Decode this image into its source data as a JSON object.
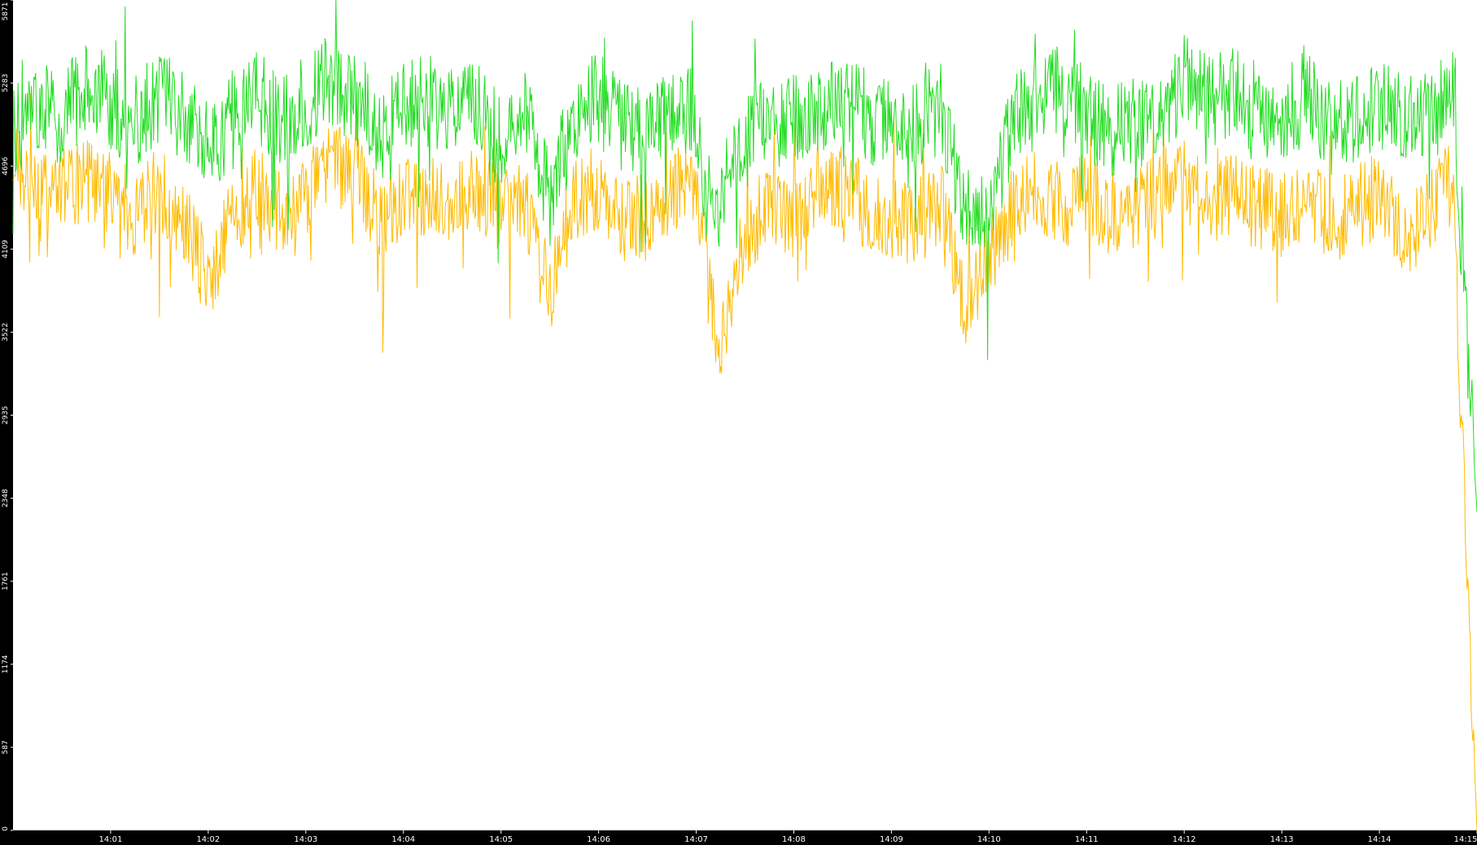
{
  "chart_data": {
    "type": "line",
    "title": "",
    "xlabel": "",
    "ylabel": "",
    "ylim": [
      0,
      5871
    ],
    "xlim": [
      "14:00:00",
      "14:15:00"
    ],
    "grid": false,
    "legend": "none",
    "background_color": "#000000",
    "plot_background_color": "#ffffff",
    "y_tick_labels": [
      "0",
      "587",
      "1174",
      "1761",
      "2348",
      "2935",
      "3522",
      "4109",
      "4696",
      "5283",
      "5871"
    ],
    "x_tick_labels": [
      "14:01",
      "14:02",
      "14:03",
      "14:04",
      "14:05",
      "14:06",
      "14:07",
      "14:08",
      "14:09",
      "14:10",
      "14:11",
      "14:12",
      "14:13",
      "14:14",
      "14:15"
    ],
    "x_tick_minutes": [
      1,
      2,
      3,
      4,
      5,
      6,
      7,
      8,
      9,
      10,
      11,
      12,
      13,
      14,
      15
    ],
    "series": [
      {
        "color": "#22dd22",
        "values": [
          [
            0.0,
            4950
          ],
          [
            0.25,
            5100
          ],
          [
            0.5,
            5050
          ],
          [
            0.75,
            5250
          ],
          [
            1.0,
            5150
          ],
          [
            1.25,
            5000
          ],
          [
            1.5,
            5200
          ],
          [
            1.75,
            5050
          ],
          [
            2.0,
            4800
          ],
          [
            2.25,
            5050
          ],
          [
            2.5,
            5200
          ],
          [
            2.75,
            5000
          ],
          [
            3.0,
            5150
          ],
          [
            3.25,
            5300
          ],
          [
            3.5,
            5200
          ],
          [
            3.75,
            4900
          ],
          [
            4.0,
            5100
          ],
          [
            4.25,
            5150
          ],
          [
            4.5,
            5050
          ],
          [
            4.75,
            5150
          ],
          [
            5.0,
            4900
          ],
          [
            5.25,
            5100
          ],
          [
            5.5,
            4450
          ],
          [
            5.75,
            5050
          ],
          [
            6.0,
            5200
          ],
          [
            6.25,
            4950
          ],
          [
            6.5,
            5000
          ],
          [
            6.75,
            5050
          ],
          [
            7.0,
            5100
          ],
          [
            7.15,
            4250
          ],
          [
            7.25,
            4500
          ],
          [
            7.5,
            5000
          ],
          [
            7.75,
            5100
          ],
          [
            8.0,
            5050
          ],
          [
            8.25,
            5100
          ],
          [
            8.5,
            5150
          ],
          [
            8.75,
            5050
          ],
          [
            9.0,
            4950
          ],
          [
            9.25,
            5000
          ],
          [
            9.5,
            5100
          ],
          [
            9.75,
            4400
          ],
          [
            10.0,
            4350
          ],
          [
            10.25,
            5050
          ],
          [
            10.5,
            5150
          ],
          [
            10.75,
            5250
          ],
          [
            11.0,
            5050
          ],
          [
            11.25,
            4950
          ],
          [
            11.5,
            5000
          ],
          [
            11.75,
            5050
          ],
          [
            12.0,
            5300
          ],
          [
            12.25,
            5150
          ],
          [
            12.5,
            5200
          ],
          [
            12.75,
            5100
          ],
          [
            13.0,
            5000
          ],
          [
            13.25,
            5250
          ],
          [
            13.5,
            4950
          ],
          [
            13.75,
            5000
          ],
          [
            14.0,
            5150
          ],
          [
            14.25,
            5050
          ],
          [
            14.5,
            5100
          ],
          [
            14.75,
            5250
          ],
          [
            15.0,
            2250
          ]
        ]
      },
      {
        "color": "#ffbb00",
        "values": [
          [
            0.0,
            4700
          ],
          [
            0.25,
            4450
          ],
          [
            0.5,
            4550
          ],
          [
            0.75,
            4600
          ],
          [
            1.0,
            4500
          ],
          [
            1.25,
            4350
          ],
          [
            1.5,
            4550
          ],
          [
            1.75,
            4300
          ],
          [
            2.0,
            3900
          ],
          [
            2.25,
            4350
          ],
          [
            2.5,
            4550
          ],
          [
            2.75,
            4350
          ],
          [
            3.0,
            4500
          ],
          [
            3.25,
            4700
          ],
          [
            3.5,
            4650
          ],
          [
            3.75,
            4300
          ],
          [
            4.0,
            4450
          ],
          [
            4.25,
            4500
          ],
          [
            4.5,
            4400
          ],
          [
            4.75,
            4550
          ],
          [
            5.0,
            4350
          ],
          [
            5.25,
            4450
          ],
          [
            5.5,
            3800
          ],
          [
            5.75,
            4450
          ],
          [
            6.0,
            4550
          ],
          [
            6.25,
            4300
          ],
          [
            6.5,
            4350
          ],
          [
            6.75,
            4500
          ],
          [
            7.0,
            4600
          ],
          [
            7.15,
            3700
          ],
          [
            7.25,
            3350
          ],
          [
            7.5,
            4200
          ],
          [
            7.75,
            4450
          ],
          [
            8.0,
            4350
          ],
          [
            8.25,
            4500
          ],
          [
            8.5,
            4550
          ],
          [
            8.75,
            4400
          ],
          [
            9.0,
            4350
          ],
          [
            9.25,
            4250
          ],
          [
            9.5,
            4450
          ],
          [
            9.75,
            3700
          ],
          [
            10.0,
            4050
          ],
          [
            10.25,
            4400
          ],
          [
            10.5,
            4550
          ],
          [
            10.75,
            4400
          ],
          [
            11.0,
            4500
          ],
          [
            11.25,
            4350
          ],
          [
            11.5,
            4400
          ],
          [
            11.75,
            4500
          ],
          [
            12.0,
            4650
          ],
          [
            12.25,
            4450
          ],
          [
            12.5,
            4500
          ],
          [
            12.75,
            4400
          ],
          [
            13.0,
            4350
          ],
          [
            13.25,
            4500
          ],
          [
            13.5,
            4300
          ],
          [
            13.75,
            4400
          ],
          [
            14.0,
            4500
          ],
          [
            14.25,
            4200
          ],
          [
            14.5,
            4350
          ],
          [
            14.75,
            4600
          ],
          [
            15.0,
            0
          ]
        ]
      }
    ]
  }
}
